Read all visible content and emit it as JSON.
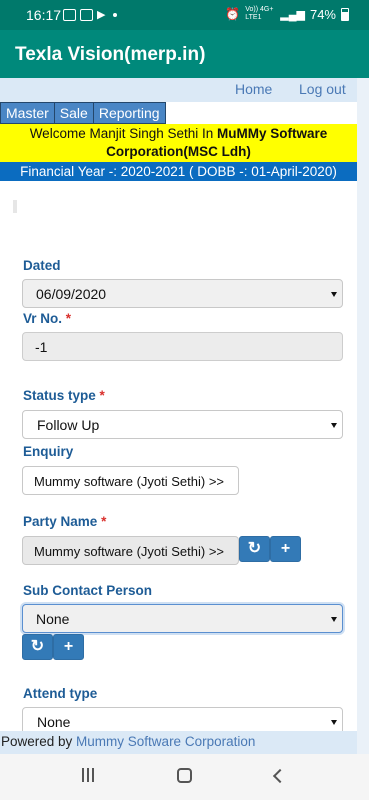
{
  "status_bar": {
    "time": "16:17",
    "network": "Vo)) 4G+ LTE1",
    "battery": "74%"
  },
  "app_bar": {
    "title": "Texla Vision(merp.in)"
  },
  "top_nav": {
    "home": "Home",
    "logout": "Log out"
  },
  "menu": {
    "items": [
      "Master",
      "Sale",
      "Reporting"
    ]
  },
  "welcome": {
    "prefix": "Welcome Manjit Singh Sethi In ",
    "company": "MuMMy Software Corporation(MSC Ldh)"
  },
  "financial_year": "Financial Year -: 2020-2021 ( DOBB -: 01-April-2020)",
  "form": {
    "dated": {
      "label": "Dated",
      "value": "06/09/2020"
    },
    "vr_no": {
      "label": "Vr No.",
      "required": "*",
      "value": "-1"
    },
    "status_type": {
      "label": "Status type",
      "required": "*",
      "value": "Follow Up"
    },
    "enquiry": {
      "label": "Enquiry",
      "value": "Mummy software (Jyoti Sethi) >>"
    },
    "party_name": {
      "label": "Party Name",
      "required": "*",
      "value": "Mummy software (Jyoti Sethi) >>"
    },
    "sub_contact": {
      "label": "Sub Contact Person",
      "value": "None"
    },
    "attend_type": {
      "label": "Attend type",
      "value": "None"
    }
  },
  "icons": {
    "refresh": "↻",
    "add": "+"
  },
  "footer": {
    "prefix": "Powered by ",
    "link": "Mummy Software Corporation"
  },
  "colors": {
    "status_bar": "#00796b",
    "app_bar": "#00897b",
    "menu": "#4a86c5",
    "welcome_bg": "#ffff00",
    "financial_bg": "#0b6cc0",
    "label": "#1e5c96",
    "button": "#337ab7"
  }
}
